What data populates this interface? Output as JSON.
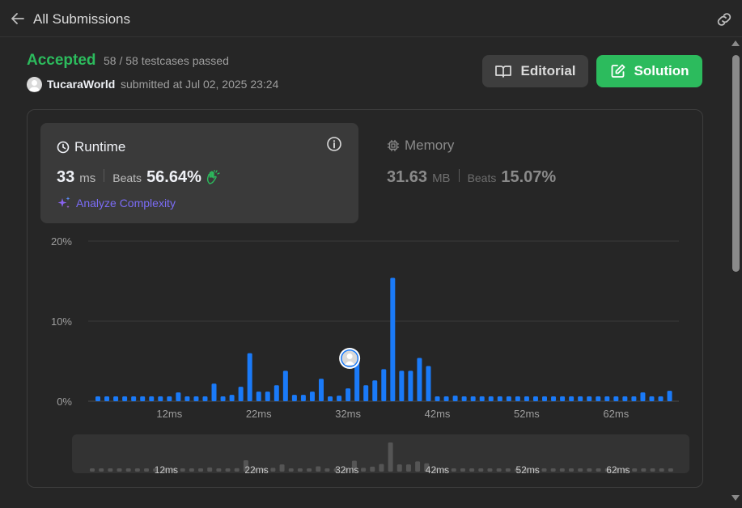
{
  "header": {
    "title": "All Submissions",
    "back_icon": "arrow-left-icon",
    "link_icon": "link-icon"
  },
  "result": {
    "status": "Accepted",
    "testcases": "58 / 58 testcases passed",
    "username": "TucaraWorld",
    "submitted": "submitted at Jul 02, 2025 23:24"
  },
  "buttons": {
    "editorial": "Editorial",
    "solution": "Solution"
  },
  "runtime": {
    "title": "Runtime",
    "value": "33",
    "unit": "ms",
    "beats_label": "Beats",
    "beats": "56.64%",
    "analyze": "Analyze Complexity"
  },
  "memory": {
    "title": "Memory",
    "value": "31.63",
    "unit": "MB",
    "beats_label": "Beats",
    "beats": "15.07%"
  },
  "colors": {
    "accepted": "#2cbb5d",
    "bar": "#1a7af8",
    "analyze": "#7b6cf6",
    "solution_button": "#2cbb5d"
  },
  "chart_data": {
    "type": "bar",
    "title": "",
    "xlabel": "",
    "ylabel": "",
    "y_ticks": [
      "20%",
      "10%",
      "0%"
    ],
    "ylim": [
      0,
      20
    ],
    "x_ticks": [
      "12ms",
      "22ms",
      "32ms",
      "42ms",
      "52ms",
      "62ms"
    ],
    "x_tick_values": [
      12,
      22,
      32,
      42,
      52,
      62
    ],
    "x_start": 4,
    "x_step": 1,
    "x_end": 68,
    "grid": true,
    "highlight_x": 33,
    "values": [
      0.6,
      0.6,
      0.6,
      0.6,
      0.6,
      0.6,
      0.6,
      0.6,
      0.6,
      1.1,
      0.6,
      0.6,
      0.6,
      2.2,
      0.6,
      0.8,
      1.8,
      6.0,
      1.2,
      1.2,
      2.0,
      3.8,
      0.8,
      0.8,
      1.2,
      2.8,
      0.6,
      0.7,
      1.6,
      5.8,
      2.0,
      2.6,
      4.0,
      15.4,
      3.8,
      3.8,
      5.4,
      4.4,
      0.6,
      0.6,
      0.7,
      0.6,
      0.6,
      0.6,
      0.6,
      0.6,
      0.6,
      0.6,
      0.6,
      0.6,
      0.6,
      0.6,
      0.6,
      0.6,
      0.6,
      0.6,
      0.6,
      0.6,
      0.6,
      0.6,
      0.6,
      1.1,
      0.6,
      0.6,
      1.3
    ]
  }
}
